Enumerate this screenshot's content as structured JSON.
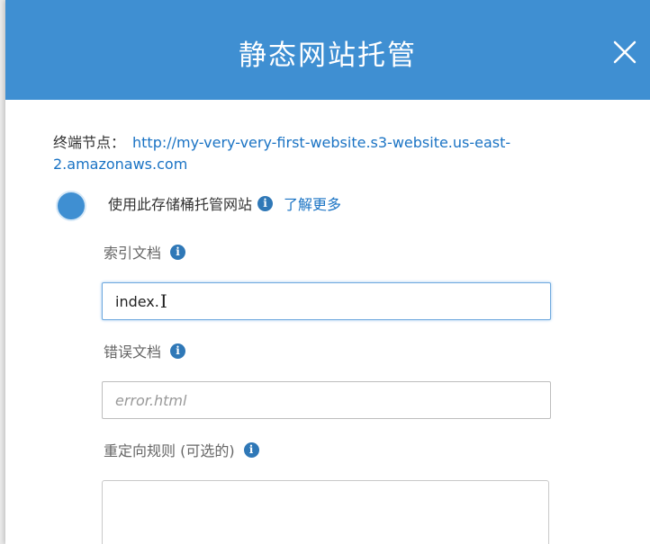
{
  "dialog": {
    "title": "静态网站托管",
    "close_icon": "close-icon"
  },
  "endpoint": {
    "label": "终端节点：",
    "url": "http://my-very-very-first-website.s3-website.us-east-2.amazonaws.com"
  },
  "hosting_option": {
    "label": "使用此存储桶托管网站",
    "learn_more": "了解更多",
    "selected": true
  },
  "index_document": {
    "label": "索引文档",
    "value": "index."
  },
  "error_document": {
    "label": "错误文档",
    "placeholder": "error.html"
  },
  "redirect_rules": {
    "label": "重定向规则 (可选的)"
  },
  "colors": {
    "header": "#3f8fd2",
    "link": "#1a73c4",
    "info_icon": "#2f78b7"
  }
}
